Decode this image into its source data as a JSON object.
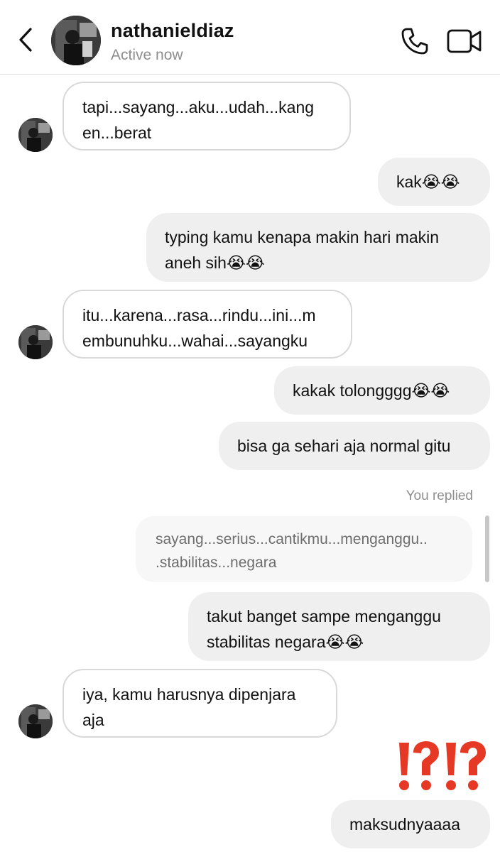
{
  "header": {
    "contact_name": "nathanieldiaz",
    "status": "Active now",
    "back_icon": "chevron-left-icon",
    "call_icon": "phone-icon",
    "video_icon": "video-camera-icon"
  },
  "messages": [
    {
      "direction": "in",
      "text": "tapi...sayang...aku...udah...kang\nen...berat"
    },
    {
      "direction": "out",
      "text": "kak😭😭"
    },
    {
      "direction": "out",
      "text": "typing kamu kenapa makin hari makin\naneh sih😭😭"
    },
    {
      "direction": "in",
      "text": "itu...karena...rasa...rindu...ini...m\nembunuhku...wahai...sayangku"
    },
    {
      "direction": "out",
      "text": "kakak tolongggg😭😭"
    },
    {
      "direction": "out",
      "text": "bisa ga sehari aja normal gitu"
    },
    {
      "direction": "out",
      "text": "takut banget sampe menganggu\nstabilitas negara😭😭"
    },
    {
      "direction": "in",
      "text": "iya, kamu harusnya dipenjara\naja"
    },
    {
      "direction": "out",
      "text": "maksudnyaaaa"
    }
  ],
  "reply": {
    "label": "You replied",
    "quoted_text": "sayang...serius...cantikmu...menganggu..\n.stabilitas...negara"
  },
  "reaction": {
    "emoji": "⁉️⁉️",
    "color": "#e53925"
  },
  "colors": {
    "incoming_bubble_border": "#d9d9d9",
    "outgoing_bubble_bg": "#efefef",
    "muted_text": "#8e8e8e"
  }
}
